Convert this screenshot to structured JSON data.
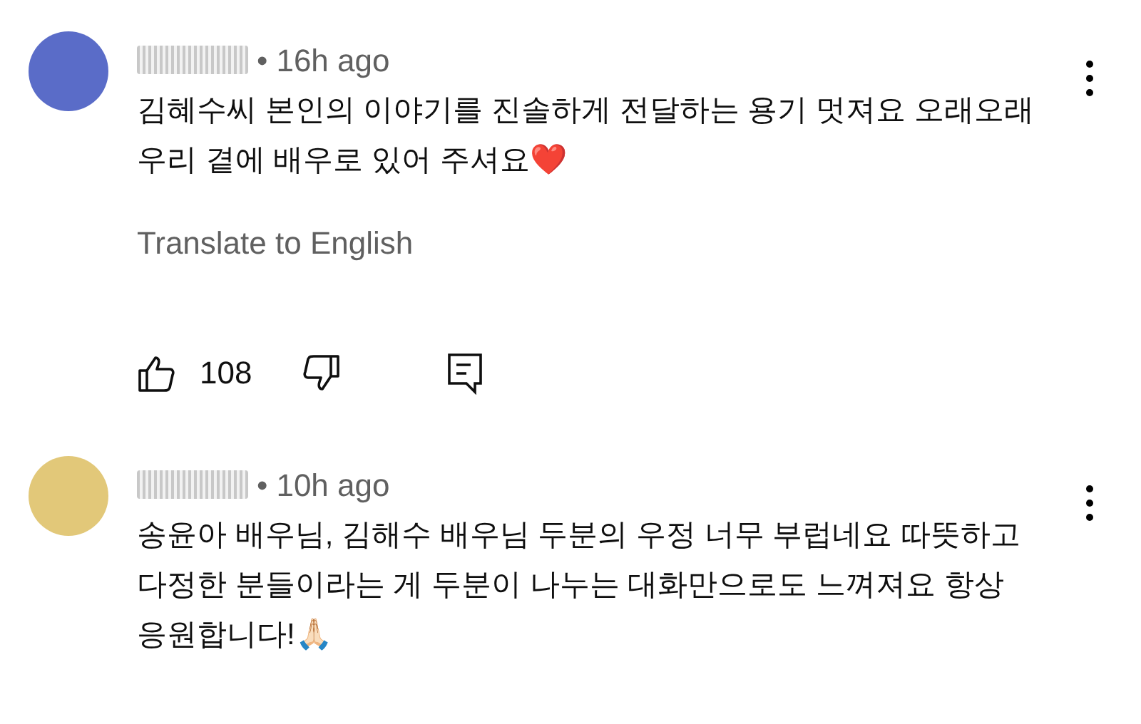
{
  "comments": [
    {
      "avatar": {
        "color": "#5a6cc8"
      },
      "separator": "•",
      "time": "16h ago",
      "text": "김혜수씨 본인의 이야기를 진솔하게 전달하는 용기 멋져요 오래오래 우리 곁에 배우로 있어 주셔요❤️",
      "translate": "Translate to English",
      "likes": "108"
    },
    {
      "avatar": {
        "color": "#e2c879"
      },
      "separator": "•",
      "time": "10h ago",
      "text": "송윤아 배우님, 김해수 배우님 두분의 우정 너무 부럽네요 따뜻하고 다정한 분들이라는 게 두분이 나누는 대화만으로도 느껴져요 항상 응원합니다!🙏🏻"
    }
  ]
}
